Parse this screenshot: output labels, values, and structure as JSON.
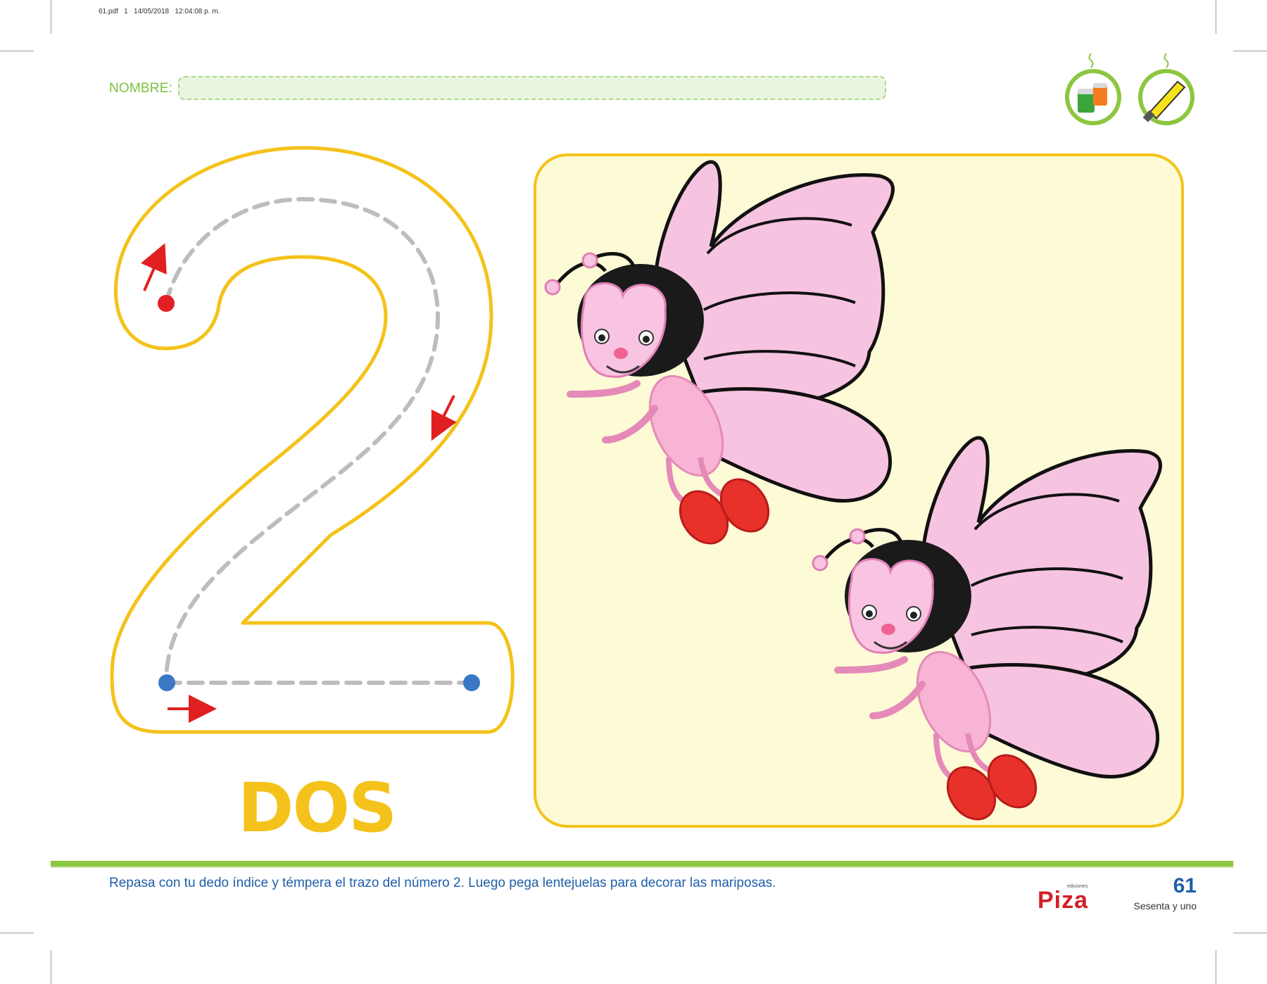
{
  "print_info": "61.pdf   1   14/05/2018   12:04:08 p. m.",
  "header": {
    "name_label": "NOMBRE:",
    "name_value": ""
  },
  "icons": [
    "paint-pots-icon",
    "glue-tube-icon"
  ],
  "tracing": {
    "digit": "2",
    "word": "DOS"
  },
  "illustration": {
    "subject": "butterflies",
    "count": 2
  },
  "footer": {
    "instruction": "Repasa con tu dedo índice y témpera el trazo del número 2. Luego pega lentejuelas para decorar las mariposas.",
    "brand_small": "ediciones",
    "brand_name": "Piza",
    "page_number": "61",
    "page_words": "Sesenta y uno"
  },
  "colors": {
    "digit_outline": "#f4c21a",
    "illustration_bg": "#fdfad6",
    "green": "#8dc63f",
    "blue_text": "#1f5fa8",
    "arrow_red": "#e02020",
    "start_dot": "#e31e24",
    "end_dot": "#3a78c6"
  }
}
